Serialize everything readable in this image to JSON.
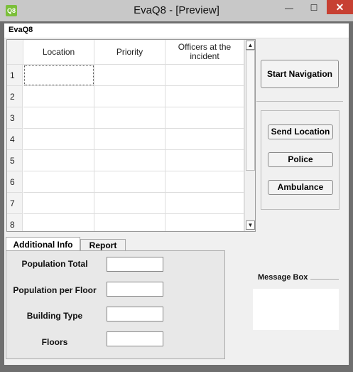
{
  "window": {
    "title": "EvaQ8 - [Preview]",
    "icon_text": "Q8",
    "min_glyph": "—",
    "max_glyph": "☐",
    "close_glyph": "✕"
  },
  "menubar": {
    "item": "EvaQ8"
  },
  "table": {
    "columns": [
      "Location",
      "Priority",
      "Officers at the incident"
    ],
    "rows": [
      "1",
      "2",
      "3",
      "4",
      "5",
      "6",
      "7",
      "8"
    ],
    "scroll_up": "▲",
    "scroll_down": "▼"
  },
  "actions": {
    "start_navigation": "Start Navigation",
    "send_location": "Send Location",
    "police": "Police",
    "ambulance": "Ambulance"
  },
  "tabs": {
    "additional_info": "Additional Info",
    "report": "Report"
  },
  "form": {
    "population_total": "Population Total",
    "population_per_floor": "Population per Floor",
    "building_type": "Building Type",
    "floors": "Floors"
  },
  "message_box": {
    "title": "Message Box"
  }
}
